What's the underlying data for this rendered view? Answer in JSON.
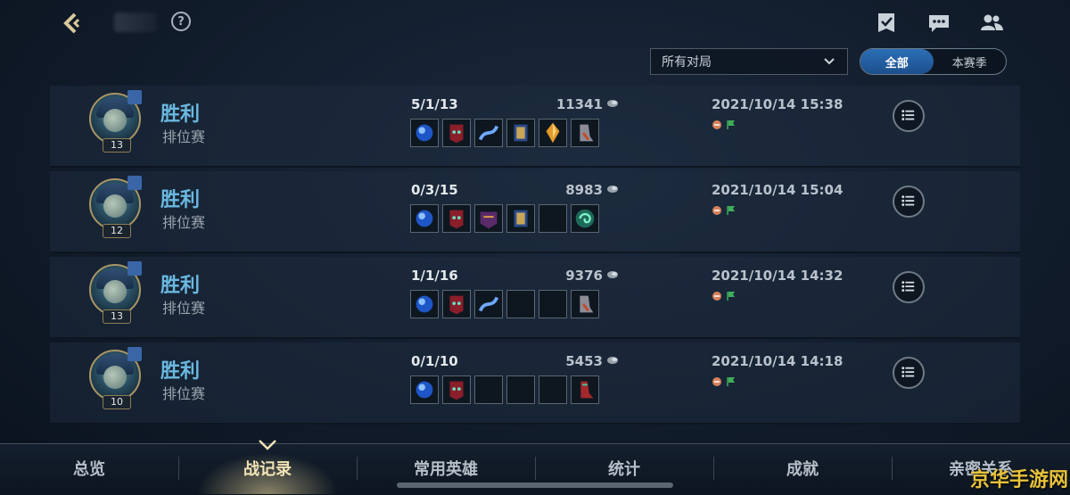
{
  "header": {
    "help_label": "?",
    "filter": {
      "selected": "所有对局"
    },
    "season_toggle": [
      {
        "label": "全部",
        "active": true
      },
      {
        "label": "本赛季",
        "active": false
      }
    ]
  },
  "matches": [
    {
      "level": "13",
      "result": "胜利",
      "mode": "排位赛",
      "kda": "5/1/13",
      "gold": "11341",
      "time": "2021/10/14 15:38",
      "items": [
        "blue-orb",
        "red-mask",
        "blue-wand",
        "blue-tome",
        "orange-crystal",
        "grey-boots"
      ]
    },
    {
      "level": "12",
      "result": "胜利",
      "mode": "排位赛",
      "kda": "0/3/15",
      "gold": "8983",
      "time": "2021/10/14 15:04",
      "items": [
        "blue-orb",
        "red-mask",
        "purple-mask",
        "blue-tome",
        "",
        "teal-ward"
      ]
    },
    {
      "level": "13",
      "result": "胜利",
      "mode": "排位赛",
      "kda": "1/1/16",
      "gold": "9376",
      "time": "2021/10/14 14:32",
      "items": [
        "blue-orb",
        "red-mask",
        "blue-wand",
        "",
        "",
        "grey-boots"
      ]
    },
    {
      "level": "10",
      "result": "胜利",
      "mode": "排位赛",
      "kda": "0/1/10",
      "gold": "5453",
      "time": "2021/10/14 14:18",
      "items": [
        "blue-orb",
        "red-mask",
        "",
        "",
        "",
        "red-boots"
      ]
    }
  ],
  "nav": [
    {
      "label": "总览",
      "active": false
    },
    {
      "label": "战记录",
      "active": true
    },
    {
      "label": "常用英雄",
      "active": false
    },
    {
      "label": "统计",
      "active": false
    },
    {
      "label": "成就",
      "active": false
    },
    {
      "label": "亲密关系",
      "active": false
    }
  ],
  "watermark": "京华手游网",
  "colors": {
    "win": "#6ab8e0",
    "accent_blue": "#2c6fb6",
    "gold_border": "#a99565"
  }
}
